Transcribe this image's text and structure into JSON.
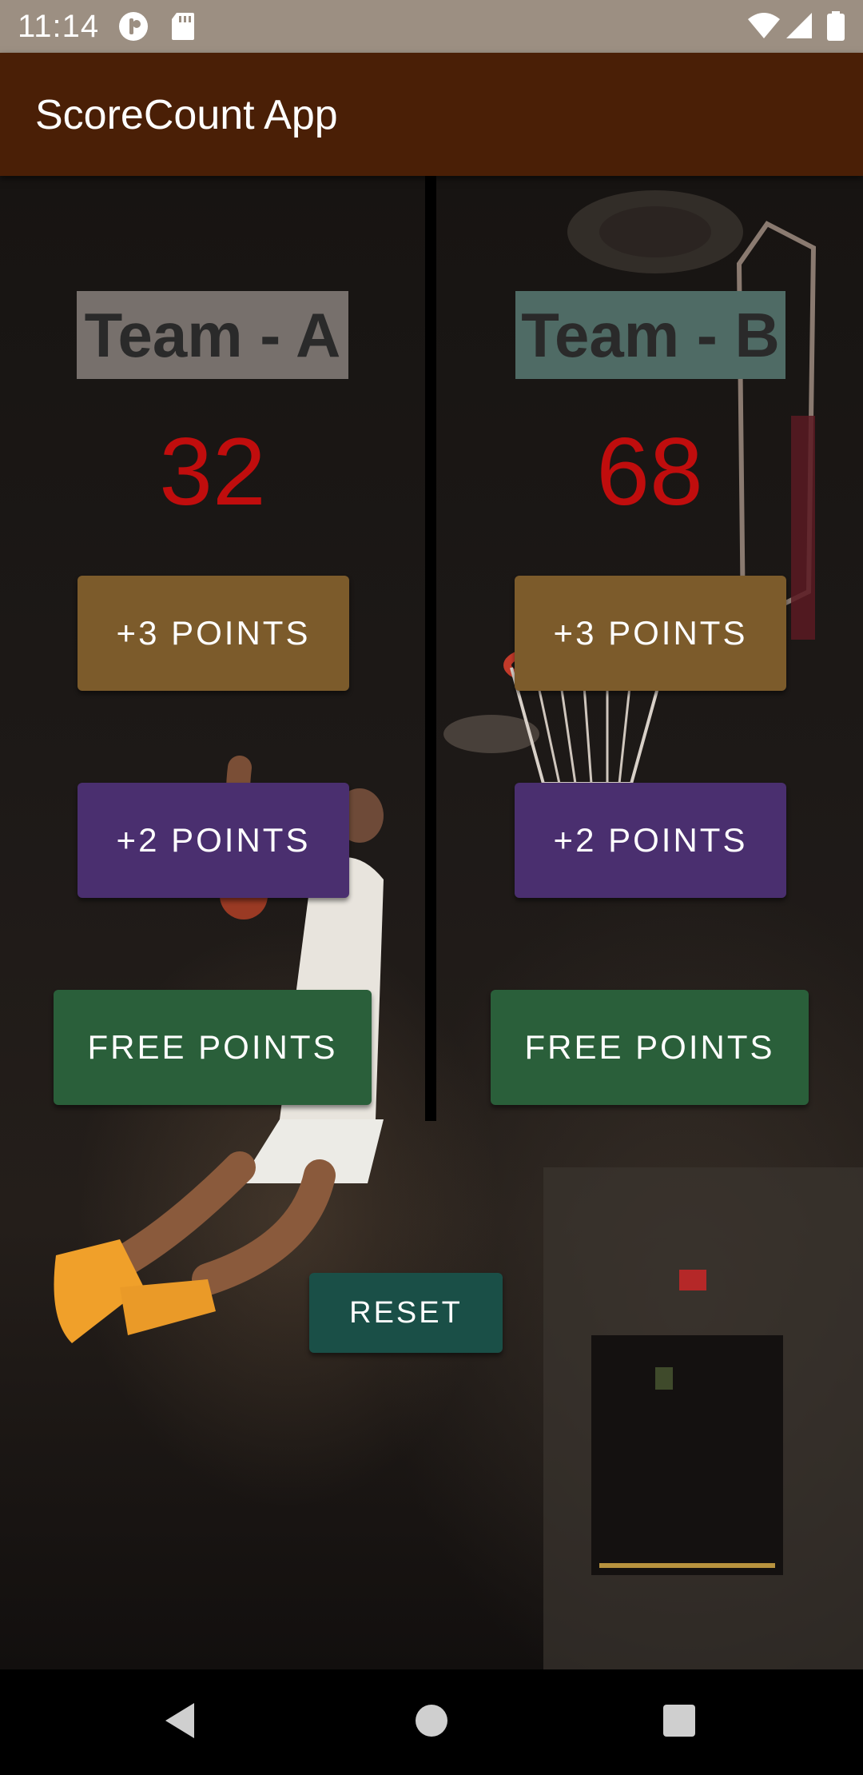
{
  "status_bar": {
    "time": "11:14",
    "icons": [
      "podcast-icon",
      "sd-card-icon",
      "wifi-icon",
      "cellular-signal-icon",
      "battery-icon"
    ]
  },
  "app_bar": {
    "title": "ScoreCount App",
    "color": "#4a1f06"
  },
  "team_a": {
    "label": "Team - A",
    "score": "32",
    "three_points_label": "+3 POINTS",
    "two_points_label": "+2 POINTS",
    "free_points_label": "FREE POINTS"
  },
  "team_b": {
    "label": "Team - B",
    "score": "68",
    "three_points_label": "+3 POINTS",
    "two_points_label": "+2 POINTS",
    "free_points_label": "FREE POINTS"
  },
  "reset_label": "RESET",
  "colors": {
    "score": "#c00d0d",
    "three_points": "#7c5b2b",
    "two_points": "#4a2f6f",
    "free_points": "#2a5f3a",
    "reset": "#1a4f47"
  },
  "nav_bar": {
    "icons": [
      "back-icon",
      "home-icon",
      "recents-icon"
    ]
  }
}
